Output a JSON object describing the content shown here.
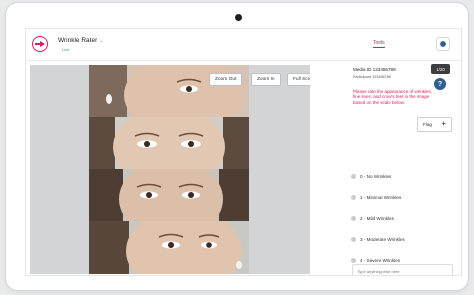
{
  "header": {
    "app_title": "Wrinkle Rater",
    "title_chevron": "⌄",
    "status": "Live",
    "tools_tab": "Tools"
  },
  "viewer": {
    "zoom_out": "Zoom Out",
    "zoom_in": "Zoom In",
    "full_screen": "Full Screen"
  },
  "panel": {
    "media_id": "Media ID 123456789",
    "participant": "Participant 123456789",
    "counter": "1/20",
    "help_icon": "?",
    "instructions": "Please rate the appearance of wrinkles, fine lines, and crow's feet in the image based on the scale below.",
    "flag_label": "Flag",
    "flag_plus": "+",
    "comment_placeholder": "Type anything else here"
  },
  "rating_options": [
    "0 - No Wrinkles",
    "1 - Minimal Wrinkles",
    "2 - Mild Wrinkles",
    "3 - Moderate Wrinkles",
    "4 - Severe Wrinkles"
  ],
  "colors": {
    "accent": "#e2195a",
    "status_live": "#3a9a4a",
    "help": "#2f5f8f",
    "counter_bg": "#3b3d40"
  }
}
